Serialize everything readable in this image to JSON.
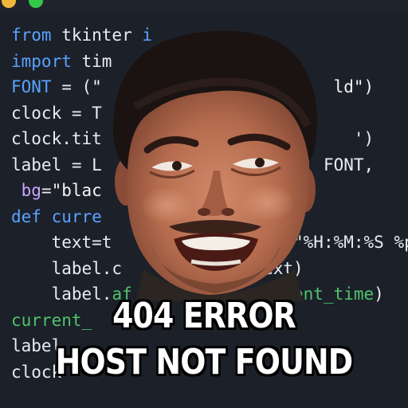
{
  "window": {
    "buttons": [
      {
        "name": "minimize",
        "color": "#f0b73b"
      },
      {
        "name": "zoom",
        "color": "#34c84a"
      }
    ]
  },
  "code_lines": [
    {
      "parts": [
        [
          "kw",
          "from "
        ],
        [
          "id",
          "tkinter "
        ],
        [
          "kw",
          "i"
        ]
      ]
    },
    {
      "parts": [
        [
          "kw",
          "import "
        ],
        [
          "id",
          "tim"
        ]
      ]
    },
    {
      "parts": [
        [
          "kw",
          "FONT "
        ],
        [
          "id",
          "= ("
        ],
        [
          "str",
          "\""
        ],
        [
          "str",
          "                       ld\")"
        ]
      ]
    },
    {
      "parts": [
        [
          "id",
          "clock "
        ],
        [
          "id",
          "= T"
        ]
      ]
    },
    {
      "parts": [
        [
          "id",
          "clock.tit"
        ],
        [
          "id",
          "                         ')"
        ]
      ]
    },
    {
      "parts": [
        [
          "id",
          "label "
        ],
        [
          "id",
          "= L"
        ],
        [
          "id",
          "                      FONT,"
        ]
      ]
    },
    {
      "parts": [
        [
          "id",
          " "
        ],
        [
          "pur",
          "bg"
        ],
        [
          "id",
          "="
        ],
        [
          "str",
          "\"blac"
        ]
      ]
    },
    {
      "parts": [
        [
          "kw",
          "def "
        ],
        [
          "fn",
          "curre"
        ]
      ]
    },
    {
      "parts": [
        [
          "id",
          "    text=t"
        ],
        [
          "id",
          "                 (\"%H:%M:%S %p"
        ]
      ]
    },
    {
      "parts": [
        [
          "id",
          "    label.c"
        ],
        [
          "id",
          "            =text)"
        ]
      ]
    },
    {
      "parts": [
        [
          "id",
          "    label."
        ],
        [
          "grn",
          "af"
        ],
        [
          "id",
          "            "
        ],
        [
          "grn",
          "current_time"
        ],
        [
          "id",
          ")"
        ]
      ]
    },
    {
      "parts": [
        [
          "grn",
          "current_"
        ]
      ]
    },
    {
      "parts": [
        [
          "id",
          "label"
        ]
      ]
    },
    {
      "parts": [
        [
          "id",
          "clock"
        ]
      ]
    }
  ],
  "meme": {
    "line1": "404 ERROR",
    "line2": "HOST NOT FOUND"
  }
}
